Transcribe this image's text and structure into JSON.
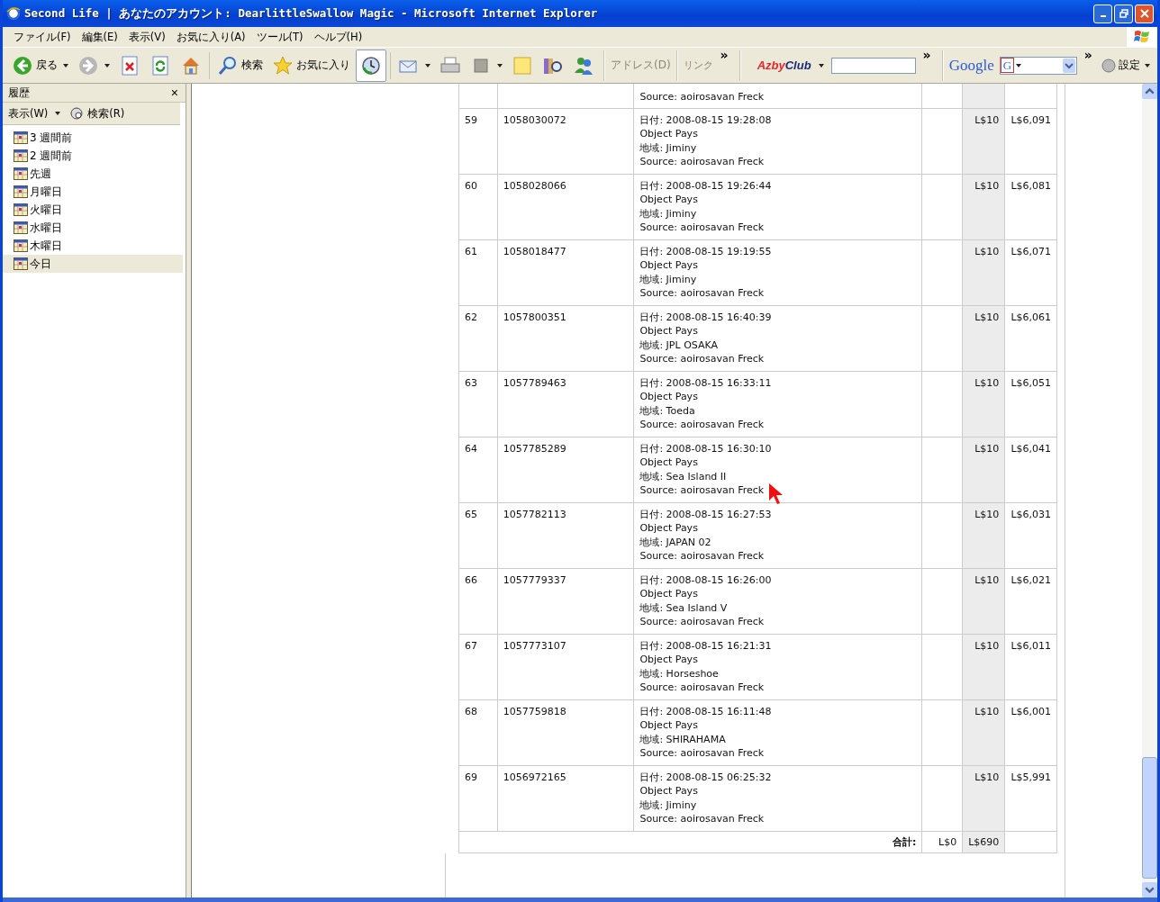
{
  "window": {
    "title": "Second Life | あなたのアカウント: DearlittleSwallow Magic - Microsoft Internet Explorer"
  },
  "menu": [
    "ファイル(F)",
    "編集(E)",
    "表示(V)",
    "お気に入り(A)",
    "ツール(T)",
    "ヘルプ(H)"
  ],
  "toolbar": {
    "buttons": [
      {
        "kind": "back",
        "label": "戻る",
        "dropdown": true,
        "selected": false
      },
      {
        "kind": "forward",
        "dropdown": true,
        "selected": false
      },
      {
        "kind": "stop",
        "selected": false
      },
      {
        "kind": "refresh",
        "selected": false
      },
      {
        "kind": "home",
        "selected": false
      },
      {
        "kind": "search",
        "label": "検索",
        "selected": false
      },
      {
        "kind": "favorites",
        "label": "お気に入り",
        "selected": false
      },
      {
        "kind": "history",
        "selected": true
      },
      {
        "kind": "mail",
        "dropdown": true,
        "selected": false
      },
      {
        "kind": "print",
        "selected": false
      },
      {
        "kind": "edit",
        "dropdown": true,
        "selected": false
      },
      {
        "kind": "notes",
        "selected": false
      },
      {
        "kind": "research",
        "selected": false
      },
      {
        "kind": "messenger",
        "selected": false
      }
    ],
    "address_label": "アドレス(D)",
    "links_label": "リンク",
    "chevron": "»",
    "azby": {
      "logo_a": "Azby",
      "logo_b": "Club",
      "chevron": "»"
    },
    "google": {
      "logo": "Google",
      "engine": "G",
      "chevron": "»",
      "settings": "設定"
    }
  },
  "sidebar": {
    "title": "履歴",
    "close": "×",
    "view_menu": "表示(W)",
    "search": "検索(R)",
    "items": [
      {
        "label": "3 週間前",
        "selected": false
      },
      {
        "label": "2 週間前",
        "selected": false
      },
      {
        "label": "先週",
        "selected": false
      },
      {
        "label": "月曜日",
        "selected": false
      },
      {
        "label": "火曜日",
        "selected": false
      },
      {
        "label": "水曜日",
        "selected": false
      },
      {
        "label": "木曜日",
        "selected": false
      },
      {
        "label": "今日",
        "selected": true
      }
    ]
  },
  "table": {
    "rows": [
      {
        "partial": true,
        "number": "",
        "id": "",
        "details": [
          "Source: aoirosavan Freck"
        ],
        "amount": "",
        "balance": ""
      },
      {
        "partial": false,
        "number": "59",
        "id": "1058030072",
        "details": [
          "日付: 2008-08-15 19:28:08",
          "Object Pays",
          "地域: Jiminy",
          "Source: aoirosavan Freck"
        ],
        "amount": "L$10",
        "balance": "L$6,091"
      },
      {
        "partial": false,
        "number": "60",
        "id": "1058028066",
        "details": [
          "日付: 2008-08-15 19:26:44",
          "Object Pays",
          "地域: Jiminy",
          "Source: aoirosavan Freck"
        ],
        "amount": "L$10",
        "balance": "L$6,081"
      },
      {
        "partial": false,
        "number": "61",
        "id": "1058018477",
        "details": [
          "日付: 2008-08-15 19:19:55",
          "Object Pays",
          "地域: Jiminy",
          "Source: aoirosavan Freck"
        ],
        "amount": "L$10",
        "balance": "L$6,071"
      },
      {
        "partial": false,
        "number": "62",
        "id": "1057800351",
        "details": [
          "日付: 2008-08-15 16:40:39",
          "Object Pays",
          "地域: JPL OSAKA",
          "Source: aoirosavan Freck"
        ],
        "amount": "L$10",
        "balance": "L$6,061"
      },
      {
        "partial": false,
        "number": "63",
        "id": "1057789463",
        "details": [
          "日付: 2008-08-15 16:33:11",
          "Object Pays",
          "地域: Toeda",
          "Source: aoirosavan Freck"
        ],
        "amount": "L$10",
        "balance": "L$6,051"
      },
      {
        "partial": false,
        "number": "64",
        "id": "1057785289",
        "details": [
          "日付: 2008-08-15 16:30:10",
          "Object Pays",
          "地域: Sea Island II",
          "Source: aoirosavan Freck"
        ],
        "amount": "L$10",
        "balance": "L$6,041"
      },
      {
        "partial": false,
        "number": "65",
        "id": "1057782113",
        "details": [
          "日付: 2008-08-15 16:27:53",
          "Object Pays",
          "地域: JAPAN 02",
          "Source: aoirosavan Freck"
        ],
        "amount": "L$10",
        "balance": "L$6,031"
      },
      {
        "partial": false,
        "number": "66",
        "id": "1057779337",
        "details": [
          "日付: 2008-08-15 16:26:00",
          "Object Pays",
          "地域: Sea Island V",
          "Source: aoirosavan Freck"
        ],
        "amount": "L$10",
        "balance": "L$6,021"
      },
      {
        "partial": false,
        "number": "67",
        "id": "1057773107",
        "details": [
          "日付: 2008-08-15 16:21:31",
          "Object Pays",
          "地域: Horseshoe",
          "Source: aoirosavan Freck"
        ],
        "amount": "L$10",
        "balance": "L$6,011"
      },
      {
        "partial": false,
        "number": "68",
        "id": "1057759818",
        "details": [
          "日付: 2008-08-15 16:11:48",
          "Object Pays",
          "地域: SHIRAHAMA",
          "Source: aoirosavan Freck"
        ],
        "amount": "L$10",
        "balance": "L$6,001"
      },
      {
        "partial": false,
        "number": "69",
        "id": "1056972165",
        "details": [
          "日付: 2008-08-15 06:25:32",
          "Object Pays",
          "地域: Jiminy",
          "Source: aoirosavan Freck"
        ],
        "amount": "L$10",
        "balance": "L$5,991"
      }
    ],
    "total": {
      "label": "合計:",
      "debit": "L$0",
      "credit": "L$690"
    }
  }
}
